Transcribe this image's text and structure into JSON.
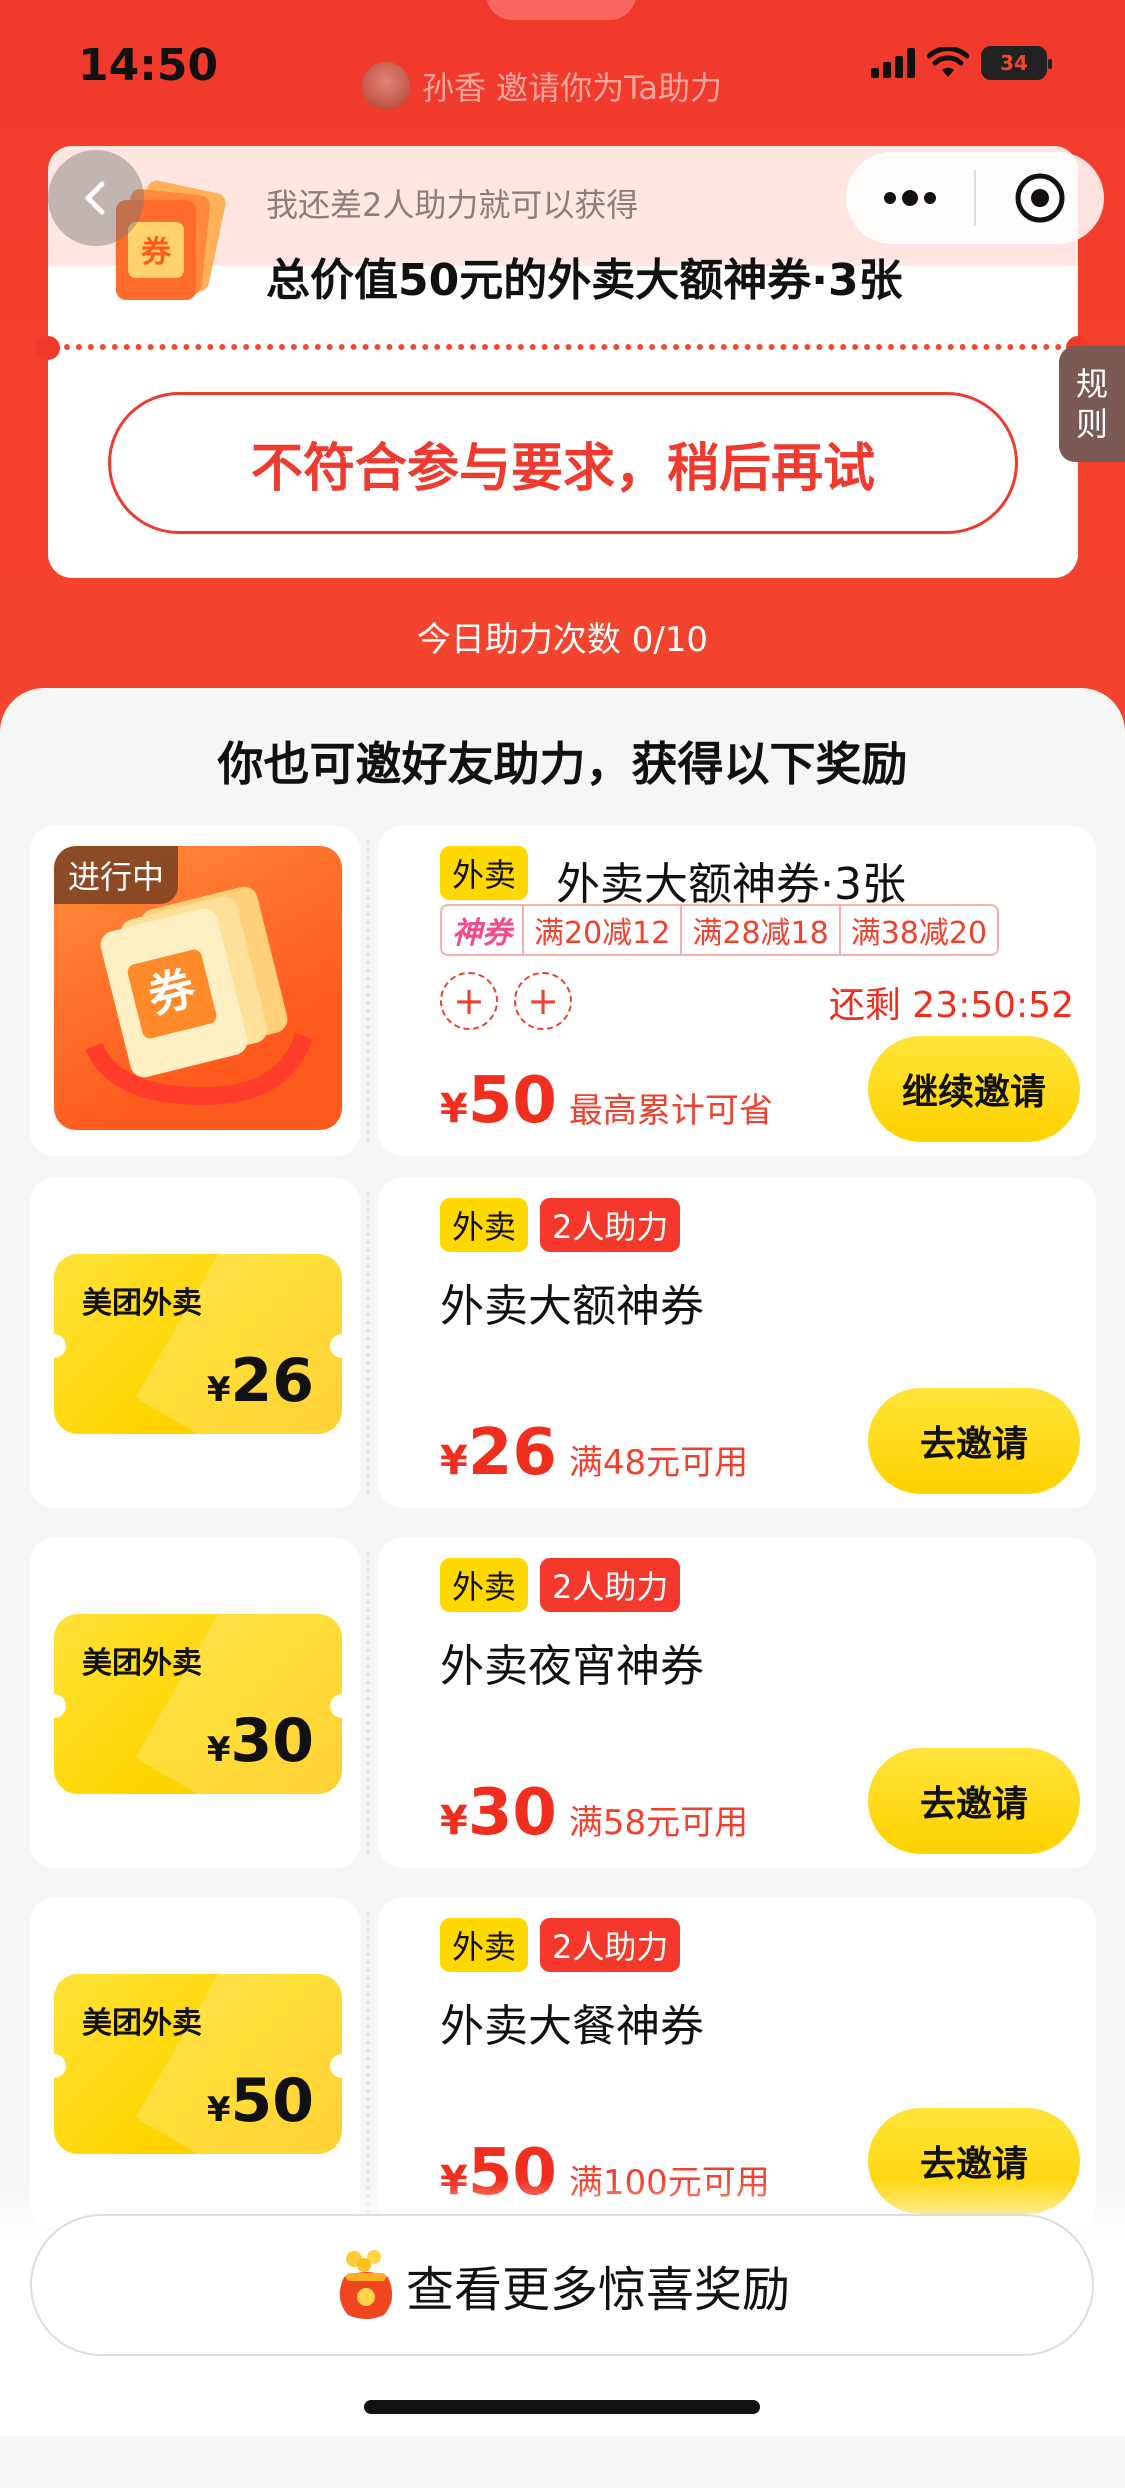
{
  "status": {
    "time": "14:50",
    "battery": "34"
  },
  "inviter": {
    "text": "孙香 邀请你为Ta助力"
  },
  "top_card": {
    "subtitle": "我还差2人助力就可以获得",
    "title": "总价值50元的外卖大额神券·3张",
    "fail_button": "不符合参与要求，稍后再试"
  },
  "rule_tab": {
    "line1": "规",
    "line2": "则"
  },
  "today": {
    "text": "今日助力次数 0/10"
  },
  "sheet": {
    "title": "你也可邀好友助力，获得以下奖励"
  },
  "reward1": {
    "progress_tag": "进行中",
    "tag": "外卖",
    "name": "外卖大额神券·3张",
    "chips": [
      "神券",
      "满20减12",
      "满28减18",
      "满38减20"
    ],
    "countdown": "还剩 23:50:52",
    "price_symbol": "¥",
    "price": "50",
    "price_desc": "最高累计可省",
    "button": "继续邀请"
  },
  "reward2": {
    "brand": "美团外卖",
    "tile_symbol": "¥",
    "tile_amount": "26",
    "tag1": "外卖",
    "tag2": "2人助力",
    "name": "外卖大额神券",
    "price_symbol": "¥",
    "price": "26",
    "condition": "满48元可用",
    "button": "去邀请"
  },
  "reward3": {
    "brand": "美团外卖",
    "tile_symbol": "¥",
    "tile_amount": "30",
    "tag1": "外卖",
    "tag2": "2人助力",
    "name": "外卖夜宵神券",
    "price_symbol": "¥",
    "price": "30",
    "condition": "满58元可用",
    "button": "去邀请"
  },
  "reward4": {
    "brand": "美团外卖",
    "tile_symbol": "¥",
    "tile_amount": "50",
    "tag1": "外卖",
    "tag2": "2人助力",
    "name": "外卖大餐神券",
    "price_symbol": "¥",
    "price": "50",
    "condition": "满100元可用",
    "button": "去邀请"
  },
  "bottom": {
    "more_label": "查看更多惊喜奖励"
  },
  "colors": {
    "brand_red": "#f0392b",
    "accent_yellow": "#ffd800",
    "price_red": "#f02e1e"
  }
}
